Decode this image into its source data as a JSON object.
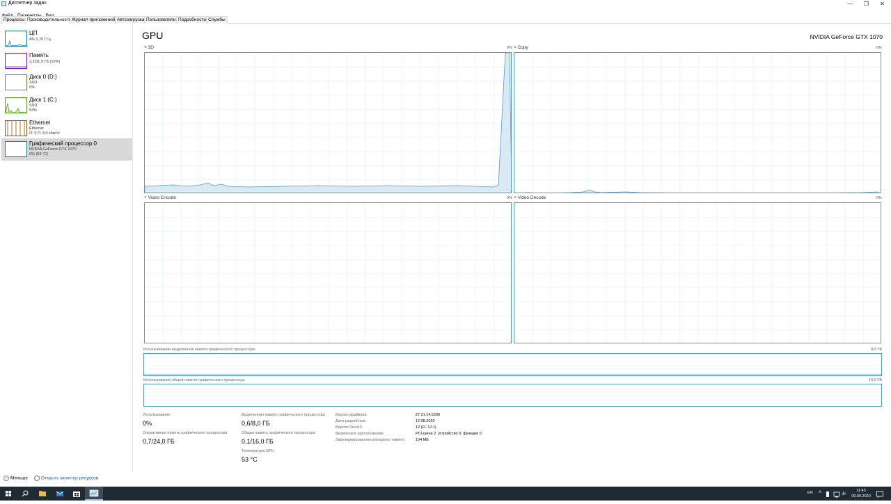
{
  "window": {
    "title": "Диспетчер задач",
    "minimize": "—",
    "maximize": "❐",
    "close": "✕"
  },
  "menu": [
    "Файл",
    "Параметры",
    "Вид"
  ],
  "tabs": [
    "Процессы",
    "Производительность",
    "Журнал приложений",
    "Автозагрузка",
    "Пользователи",
    "Подробности",
    "Службы"
  ],
  "active_tab": "Производительность",
  "sidebar": [
    {
      "name": "ЦП",
      "sub1": "4% 3,76 ГГц",
      "sub2": "",
      "color": "#117dbb"
    },
    {
      "name": "Память",
      "sub1": "3,2/31,9 ГБ (10%)",
      "sub2": "",
      "color": "#8b12ae"
    },
    {
      "name": "Диск 0 (D:)",
      "sub1": "SSD",
      "sub2": "0%",
      "color": "#4da60c"
    },
    {
      "name": "Диск 1 (C:)",
      "sub1": "SSD",
      "sub2": "93%",
      "color": "#4da60c"
    },
    {
      "name": "Ethernet",
      "sub1": "Ethernet",
      "sub2": "О: 0  П: 8,0 кбит/с",
      "color": "#a74f01"
    },
    {
      "name": "Графический процессор 0",
      "sub1": "NVIDIA GeForce GTX 1070",
      "sub2": "0% (53 °C)",
      "color": "#117dbb"
    }
  ],
  "main": {
    "title": "GPU",
    "model": "NVIDIA GeForce GTX 1070",
    "graph_color": "#4f9cc9",
    "panels": [
      {
        "label": "3D",
        "pct": "0%"
      },
      {
        "label": "Copy",
        "pct": "0%"
      },
      {
        "label": "Video Encode",
        "pct": "0%"
      },
      {
        "label": "Video Decode",
        "pct": "0%"
      }
    ],
    "dedicated_label": "Использование выделенной памяти графического процессора",
    "dedicated_max": "8,0 ГБ",
    "shared_label": "Использование общей памяти графического процессора",
    "shared_max": "16,0 ГБ",
    "stats": {
      "usage_label": "Использование",
      "usage_value": "0%",
      "dedicated_label": "Выделенная память графического процессора",
      "dedicated_value": "0,6/8,0 ГБ",
      "gpu_memory_label": "Оперативная память графического процессора",
      "gpu_memory_value": "0,7/24,0 ГБ",
      "shared_label": "Общая память графического процессора",
      "shared_value": "0,1/16,0 ГБ",
      "temp_label": "Температура GPU",
      "temp_value": "53 °C"
    },
    "info": [
      {
        "key": "Версия драйвера:",
        "value": "27.21.14.5206"
      },
      {
        "key": "Дата разработки:",
        "value": "12.08.2020"
      },
      {
        "key": "Версия DirectX:",
        "value": "12 (FL 12.1)"
      },
      {
        "key": "Физическое расположение:",
        "value": "PCI-шина 2, устройство 0, функция 0"
      },
      {
        "key": "Зарезервированная аппаратно память:",
        "value": "104 МБ"
      }
    ]
  },
  "footer": {
    "less": "Меньше",
    "resource_monitor": "Открыть монитор ресурсов"
  },
  "taskbar": {
    "lang": "EN",
    "time": "11:43",
    "date": "09.09.2020"
  }
}
